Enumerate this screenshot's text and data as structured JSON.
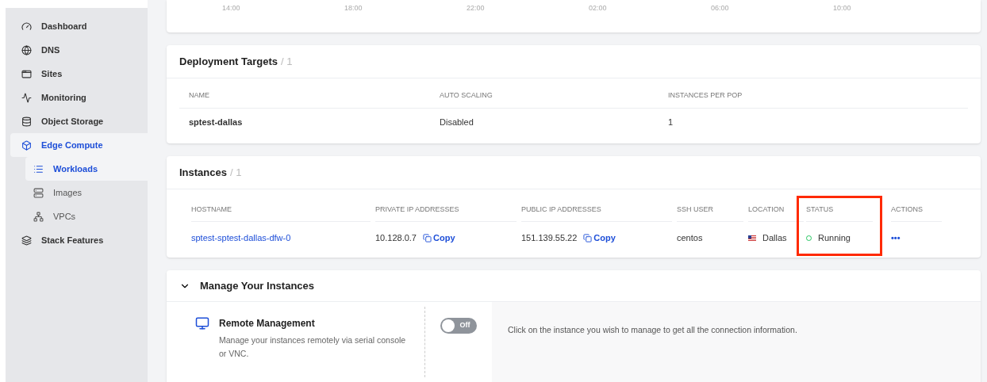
{
  "sidebar": {
    "items": [
      {
        "label": "Dashboard",
        "selected": false
      },
      {
        "label": "DNS",
        "selected": false
      },
      {
        "label": "Sites",
        "selected": false
      },
      {
        "label": "Monitoring",
        "selected": false
      },
      {
        "label": "Object Storage",
        "selected": false
      },
      {
        "label": "Edge Compute",
        "selected": true,
        "expanded": true,
        "children": [
          {
            "label": "Workloads",
            "selected": true
          },
          {
            "label": "Images",
            "selected": false
          },
          {
            "label": "VPCs",
            "selected": false
          }
        ]
      },
      {
        "label": "Stack Features",
        "selected": false
      }
    ]
  },
  "chart_axis": {
    "ticks": [
      "14:00",
      "18:00",
      "22:00",
      "02:00",
      "06:00",
      "10:00"
    ]
  },
  "deployment_targets": {
    "title": "Deployment Targets",
    "count": "/ 1",
    "columns": [
      "NAME",
      "AUTO SCALING",
      "INSTANCES PER POP"
    ],
    "rows": [
      [
        "sptest-dallas",
        "Disabled",
        "1"
      ]
    ]
  },
  "instances": {
    "title": "Instances",
    "count": "/ 1",
    "columns": [
      {
        "label": "HOSTNAME",
        "highlighted": false
      },
      {
        "label": "PRIVATE IP ADDRESSES",
        "highlighted": false
      },
      {
        "label": "PUBLIC IP ADDRESSES",
        "highlighted": false
      },
      {
        "label": "SSH USER",
        "highlighted": false
      },
      {
        "label": "LOCATION",
        "highlighted": false
      },
      {
        "label": "STATUS",
        "highlighted": true
      },
      {
        "label": "ACTIONS",
        "highlighted": false
      }
    ],
    "rows": [
      {
        "hostname": "sptest-sptest-dallas-dfw-0",
        "private_ip": "10.128.0.7",
        "private_copy": "Copy",
        "public_ip": "151.139.55.22",
        "public_copy": "Copy",
        "ssh_user": "centos",
        "location": "Dallas",
        "status": "Running",
        "actions": "•••"
      }
    ]
  },
  "manage": {
    "title": "Manage Your Instances",
    "expanded": true,
    "feature": {
      "title": "Remote Management",
      "description": "Manage your instances remotely via serial console or VNC.",
      "toggle": {
        "on": false,
        "label": "Off"
      },
      "hint": "Click on the instance you wish to manage to get all the connection information."
    }
  }
}
